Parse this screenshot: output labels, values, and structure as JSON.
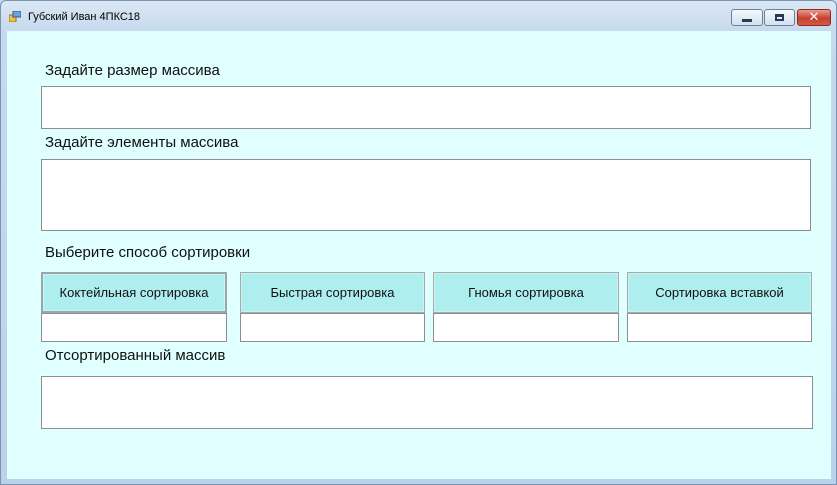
{
  "window": {
    "title": "Губский Иван 4ПКС18",
    "controls": [
      "minimize",
      "maximize",
      "close"
    ],
    "close_glyph": "✕"
  },
  "form": {
    "size_label": "Задайте размер массива",
    "size_value": "",
    "elements_label": "Задайте элементы массива",
    "elements_value": "",
    "sort_label": "Выберите способ сортировки",
    "sort_buttons": [
      {
        "label": "Коктейльная сортировка",
        "result": ""
      },
      {
        "label": "Быстрая сортировка",
        "result": ""
      },
      {
        "label": "Гномья сортировка",
        "result": ""
      },
      {
        "label": "Сортировка вставкой",
        "result": ""
      }
    ],
    "sorted_label": "Отсортированный массив",
    "sorted_value": ""
  },
  "colors": {
    "client_bg": "#e0ffff",
    "button_bg": "#aeeeee"
  }
}
